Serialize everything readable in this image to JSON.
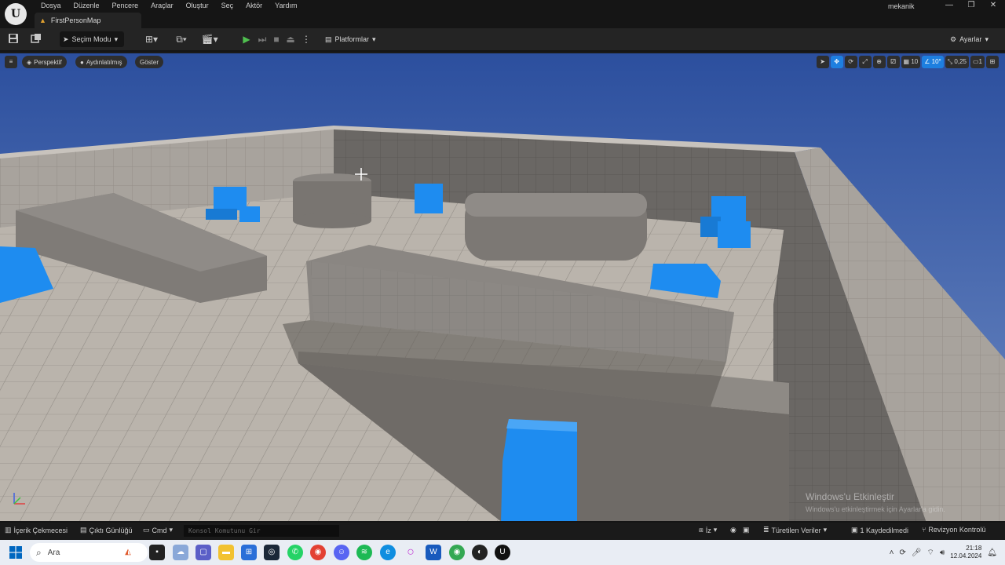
{
  "menu": {
    "items": [
      "Dosya",
      "Düzenle",
      "Pencere",
      "Araçlar",
      "Oluştur",
      "Seç",
      "Aktör",
      "Yardım"
    ]
  },
  "tab": {
    "label": "FirstPersonMap"
  },
  "user": {
    "name": "mekanik"
  },
  "window_controls": {
    "minimize": "—",
    "restore": "❐",
    "close": "✕"
  },
  "toolbar": {
    "mode_label": "Seçim Modu",
    "platform_label": "Platformlar",
    "settings_label": "Ayarlar"
  },
  "viewport": {
    "perspective_label": "Perspektif",
    "lighting_label": "Aydınlatılmış",
    "show_label": "Göster",
    "grid_snap_value": "10",
    "rotation_snap_value": "10°",
    "scale_snap_value": "0,25",
    "watermark_line1": "Windows'u Etkinleştir",
    "watermark_line2": "Windows'u etkinleştirmek için Ayarlar'a gidin."
  },
  "statusbar": {
    "content_drawer": "İçerik Çekmecesi",
    "output_log": "Çıktı Günlüğü",
    "cmd_label": "Cmd",
    "console_placeholder": "Konsol Komutunu Gir",
    "trace_label": "İz",
    "derived_data": "Türetilen Veriler",
    "saved": "1 Kaydedilmedi",
    "revision": "Revizyon Kontrolü"
  },
  "taskbar": {
    "search_placeholder": "Ara",
    "time": "21:18",
    "date": "12.04.2024",
    "accent": "#0067c0"
  },
  "colors": {
    "viewport_sky": "#2b4d99",
    "cube_blue": "#1e8cf0",
    "floor": "#b9b3ab",
    "wall": "#8a8682"
  }
}
